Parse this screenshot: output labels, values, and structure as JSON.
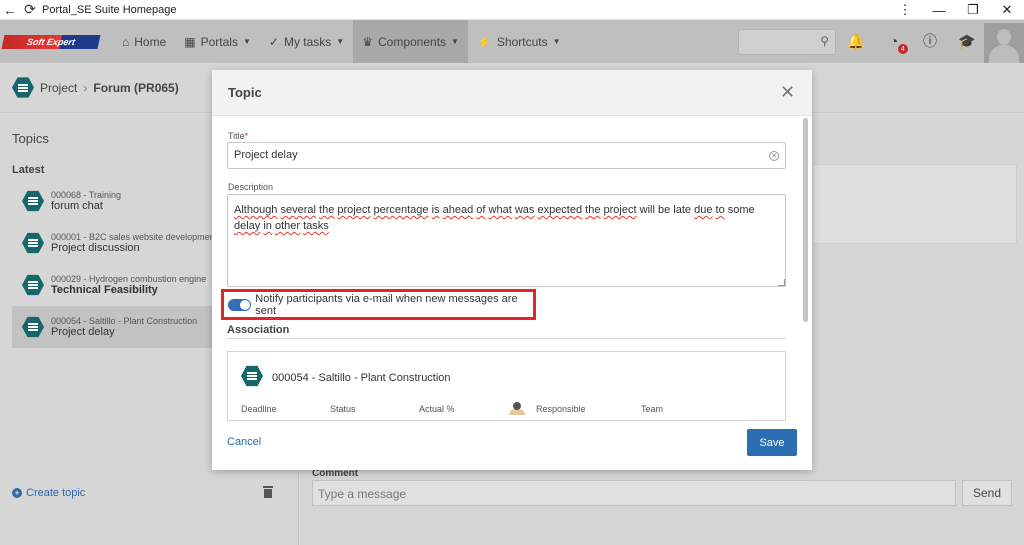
{
  "browser": {
    "title": "Portal_SE Suite Homepage"
  },
  "navbar": {
    "logo_text": "Soft Expert",
    "items": [
      {
        "label": "Home",
        "icon": "home-icon"
      },
      {
        "label": "Portals",
        "icon": "grid-icon"
      },
      {
        "label": "My tasks",
        "icon": "check-icon"
      },
      {
        "label": "Components",
        "icon": "trophy-icon"
      },
      {
        "label": "Shortcuts",
        "icon": "bolt-icon"
      }
    ],
    "badge_count": "4"
  },
  "breadcrumb": {
    "item1": "Project",
    "item2": "Forum (PR065)"
  },
  "sidebar": {
    "title": "Topics",
    "subtitle": "Latest",
    "topics": [
      {
        "code": "000068 - Training",
        "name": "forum chat",
        "bold": false
      },
      {
        "code": "000001 - B2C sales website developmen",
        "name": "Project discussion",
        "bold": false
      },
      {
        "code": "000029 - Hydrogen combustion engine",
        "name": "Technical Feasibility",
        "bold": true
      },
      {
        "code": "000054 - Saltillo - Plant Construction",
        "name": "Project delay",
        "bold": false
      }
    ],
    "create_topic": "Create topic"
  },
  "comment": {
    "label": "Comment",
    "placeholder": "Type a message",
    "send": "Send"
  },
  "modal": {
    "title": "Topic",
    "title_label": "Title",
    "title_required": "*",
    "title_value": "Project delay",
    "description_label": "Description",
    "description_words": [
      "Although",
      "several",
      "the",
      "project",
      "percentage",
      "is",
      "ahead",
      "of",
      "what",
      "was",
      "expected",
      "the",
      "project",
      "will",
      "be",
      "late",
      "due",
      "to",
      "some",
      "delay",
      "in",
      "other",
      "tasks"
    ],
    "description_misspelled": [
      0,
      1,
      2,
      3,
      4,
      5,
      6,
      7,
      8,
      9,
      10,
      11,
      12,
      16,
      17,
      19,
      20,
      21,
      22
    ],
    "notify_label": "Notify participants via e-mail when new messages are sent",
    "notify_enabled": true,
    "association_title": "Association",
    "association_item": "000054 - Saltillo - Plant Construction",
    "columns": [
      "Deadline",
      "Status",
      "Actual %",
      "Responsible",
      "Team"
    ],
    "cancel": "Cancel",
    "save": "Save"
  },
  "colors": {
    "accent": "#2d6db1",
    "highlight": "#e3252b",
    "teal": "#17666b"
  }
}
